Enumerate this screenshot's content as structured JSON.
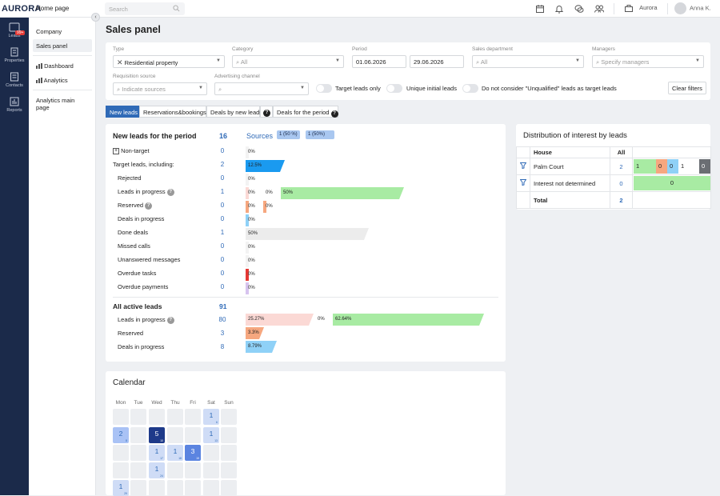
{
  "topbar": {
    "logo": "AURORA",
    "home": "Home page",
    "search_placeholder": "Search",
    "company": "Aurora",
    "user": "Anna K."
  },
  "rail": {
    "items": [
      {
        "label": "Leads",
        "badge": "99+"
      },
      {
        "label": "Properties"
      },
      {
        "label": "Contacts"
      },
      {
        "label": "Reports"
      }
    ]
  },
  "nav": {
    "items": [
      "Company",
      "Sales panel",
      "Dashboard",
      "Analytics",
      "Analytics main page"
    ]
  },
  "page": {
    "title": "Sales panel"
  },
  "filters": {
    "type": {
      "label": "Type",
      "value": "Residential property"
    },
    "category": {
      "label": "Category",
      "value": "All"
    },
    "period": {
      "label": "Period",
      "from": "01.06.2026",
      "to": "29.06.2026"
    },
    "sales_department": {
      "label": "Sales department",
      "value": "All"
    },
    "managers": {
      "label": "Managers",
      "placeholder": "Specify managers"
    },
    "requisition_source": {
      "label": "Requisition source",
      "placeholder": "Indicate sources"
    },
    "advertising_channel": {
      "label": "Advertising channel",
      "value": ""
    },
    "toggles": [
      "Target leads only",
      "Unique initial leads",
      "Do not consider \"Unqualified\" leads as target leads"
    ],
    "clear": "Clear filters"
  },
  "tabs": [
    "New leads",
    "Reservations&bookings",
    "Deals by new leads",
    "Deals for the period"
  ],
  "leads": {
    "title": "New leads for the period",
    "count": "16",
    "sources_label": "Sources",
    "source_badges": [
      "1 (50 %)",
      "1 (50%)"
    ],
    "rows": [
      {
        "label": "Non-target",
        "value": "0",
        "bars": [
          {
            "text": "0%",
            "frac": 0
          }
        ]
      },
      {
        "label": "Target leads, including:",
        "value": "2",
        "bars": [
          {
            "text": "12.5%",
            "frac": 0.125
          }
        ]
      },
      {
        "label": "Rejected",
        "value": "0",
        "bars": [
          {
            "text": "0%",
            "frac": 0
          }
        ]
      },
      {
        "label": "Leads in progress",
        "value": "1",
        "bars": [
          {
            "text": "0%",
            "frac": 0
          },
          {
            "text": "0%",
            "frac": 0
          },
          {
            "text": "50%",
            "frac": 0.5
          }
        ]
      },
      {
        "label": "Reserved",
        "value": "0",
        "bars": [
          {
            "text": "0%",
            "frac": 0
          },
          {
            "text": "0%",
            "frac": 0
          }
        ]
      },
      {
        "label": "Deals in progress",
        "value": "0",
        "bars": [
          {
            "text": "0%",
            "frac": 0
          }
        ]
      },
      {
        "label": "Done deals",
        "value": "1",
        "bars": [
          {
            "text": "50%",
            "frac": 0.5
          }
        ]
      },
      {
        "label": "Missed calls",
        "value": "0",
        "bars": [
          {
            "text": "0%",
            "frac": 0
          }
        ]
      },
      {
        "label": "Unanswered messages",
        "value": "0",
        "bars": [
          {
            "text": "0%",
            "frac": 0
          }
        ]
      },
      {
        "label": "Overdue tasks",
        "value": "0",
        "bars": [
          {
            "text": "0%",
            "frac": 0
          }
        ]
      },
      {
        "label": "Overdue payments",
        "value": "0",
        "bars": [
          {
            "text": "0%",
            "frac": 0
          }
        ]
      }
    ],
    "active_title": "All active leads",
    "active_count": "91",
    "active_rows": [
      {
        "label": "Leads in progress",
        "value": "80",
        "bars": [
          {
            "text": "25.27%",
            "frac": 0.2527
          },
          {
            "text": "0%",
            "frac": 0
          },
          {
            "text": "62.64%",
            "frac": 0.6264
          }
        ]
      },
      {
        "label": "Reserved",
        "value": "3",
        "bars": [
          {
            "text": "3.3%",
            "frac": 0.033
          }
        ]
      },
      {
        "label": "Deals in progress",
        "value": "8",
        "bars": [
          {
            "text": "8.79%",
            "frac": 0.0879
          }
        ]
      }
    ]
  },
  "distribution": {
    "title": "Distribution of interest by leads",
    "headers": [
      "House",
      "All"
    ],
    "rows": [
      {
        "house": "Palm Court",
        "all": "2",
        "segments": [
          "1",
          "0",
          "0",
          "1",
          "0"
        ]
      },
      {
        "house": "Interest not determined",
        "all": "0",
        "segments": [
          "0"
        ]
      }
    ],
    "total_label": "Total",
    "total": "2"
  },
  "calendar": {
    "title": "Calendar",
    "weekdays": [
      "Mon",
      "Tue",
      "Wed",
      "Thu",
      "Fri",
      "Sat",
      "Sun"
    ],
    "cells": [
      {
        "col": 5,
        "row": 0,
        "n": "1",
        "d": "6"
      },
      {
        "col": 0,
        "row": 1,
        "n": "2",
        "d": "8"
      },
      {
        "col": 2,
        "row": 1,
        "n": "5",
        "d": "10"
      },
      {
        "col": 5,
        "row": 1,
        "n": "1",
        "d": "13"
      },
      {
        "col": 2,
        "row": 2,
        "n": "1",
        "d": "17"
      },
      {
        "col": 3,
        "row": 2,
        "n": "1",
        "d": "18"
      },
      {
        "col": 4,
        "row": 2,
        "n": "3",
        "d": "19"
      },
      {
        "col": 2,
        "row": 3,
        "n": "1",
        "d": "24"
      },
      {
        "col": 0,
        "row": 4,
        "n": "1",
        "d": "29"
      }
    ]
  },
  "colors": {
    "navy": "#1b2a4a",
    "accent": "#2f6ab7",
    "blue_bar": "#1a9af0",
    "green": "#a8eba3",
    "pink": "#fbd9d5",
    "orange": "#f6a77f",
    "light_blue": "#8fd1f7",
    "grey_bar": "#ececec"
  }
}
